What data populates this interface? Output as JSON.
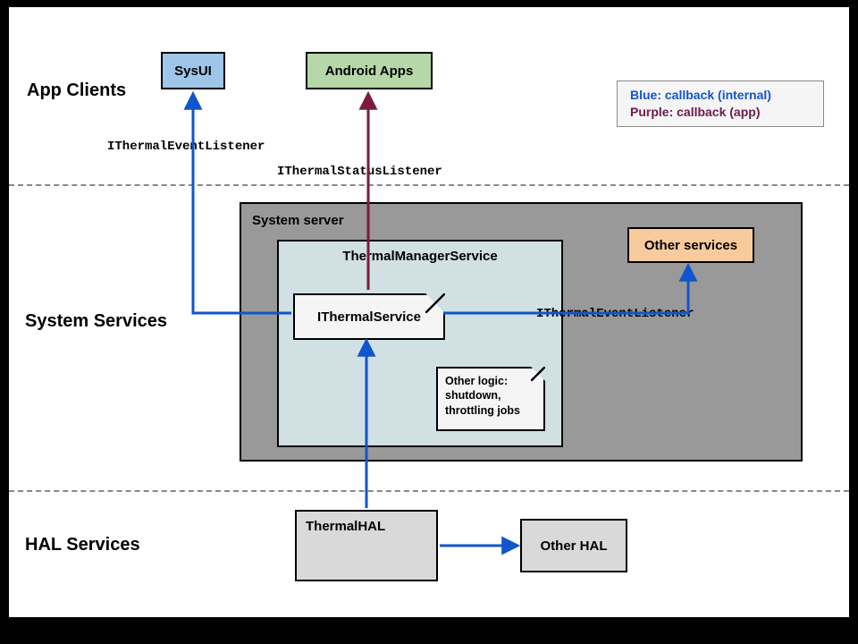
{
  "sections": {
    "app_clients": "App Clients",
    "system_services": "System Services",
    "hal_services": "HAL Services"
  },
  "boxes": {
    "sysui": "SysUI",
    "android_apps": "Android Apps",
    "system_server": "System server",
    "thermal_manager_service": "ThermalManagerService",
    "ithermal_service": "IThermalService",
    "other_logic": "Other logic: shutdown, throttling jobs",
    "other_services": "Other services",
    "thermal_hal": "ThermalHAL",
    "other_hal": "Other HAL"
  },
  "connectors": {
    "ithermal_event_listener_left": "IThermalEventListener",
    "ithermal_status_listener": "IThermalStatusListener",
    "ithermal_event_listener_right": "IThermalEventListener"
  },
  "legend": {
    "blue": "Blue: callback (internal)",
    "purple": "Purple: callback (app)"
  },
  "colors": {
    "blue": "#1155cc",
    "purple": "#7b1c3b",
    "sysui_fill": "#9fc5e8",
    "apps_fill": "#b6d7a8",
    "server_fill": "#999999",
    "tms_fill": "#d0e0e3",
    "other_services_fill": "#f9cb9c",
    "hal_fill": "#d9d9d9"
  }
}
